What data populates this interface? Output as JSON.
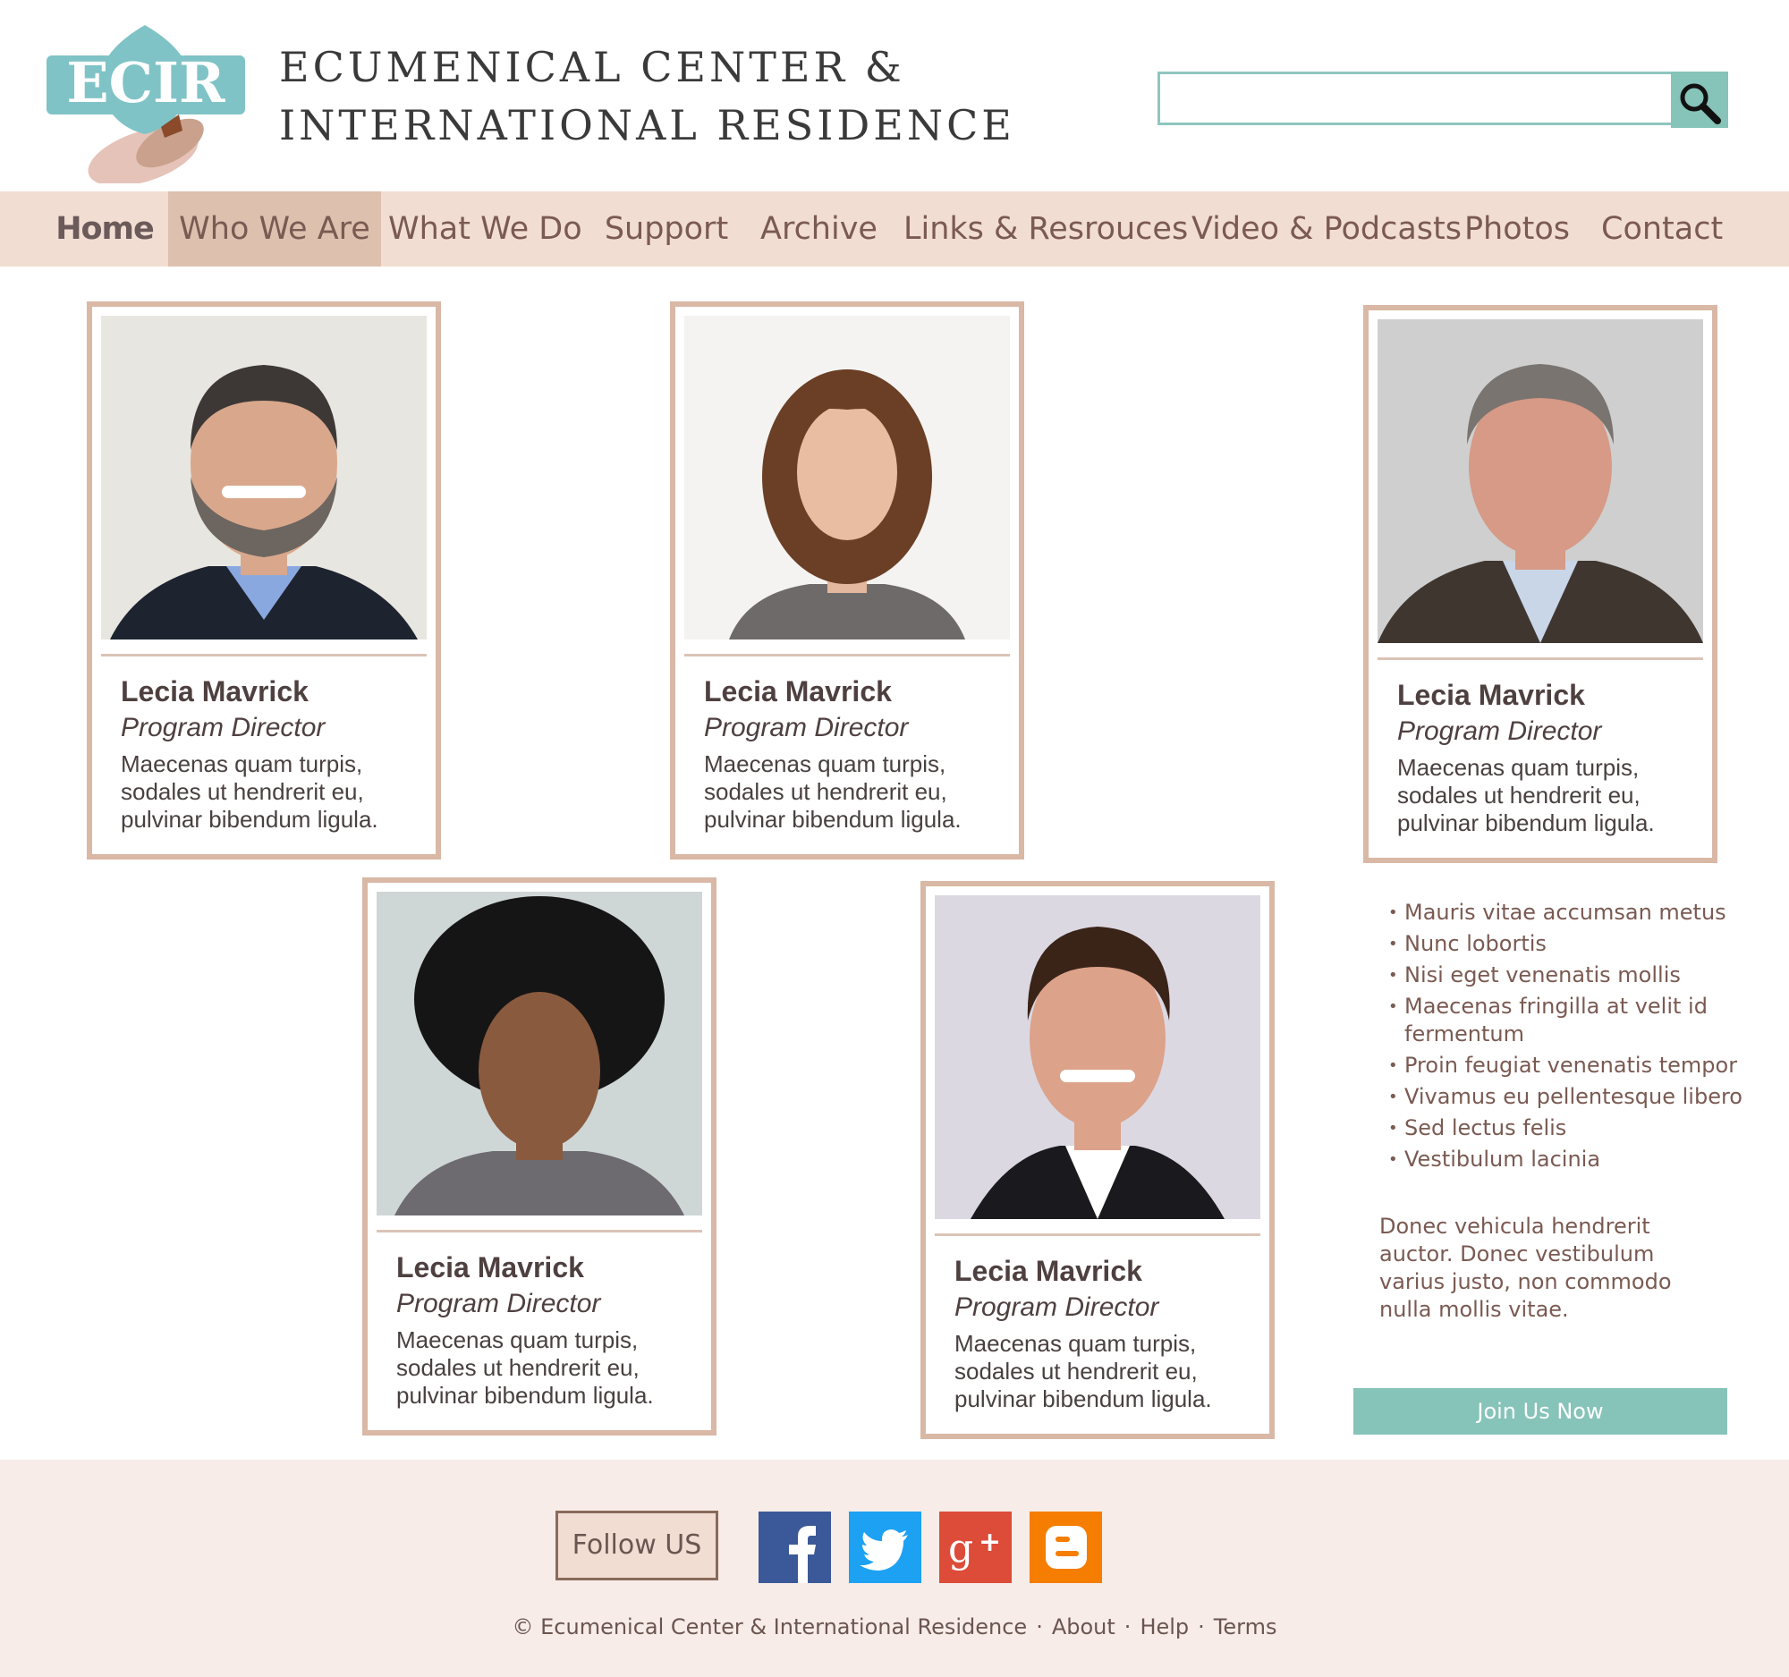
{
  "brand": {
    "logo_text": "ECIR",
    "title_line1": "ECUMENICAL CENTER &",
    "title_line2": "INTERNATIONAL RESIDENCE",
    "colors": {
      "teal": "#86c3b9",
      "nav_bg": "#f2ddd3",
      "card_border": "#d9b8a6",
      "footer_bg": "#f7ece8"
    }
  },
  "search": {
    "placeholder": "",
    "value": "",
    "button_icon": "search-icon"
  },
  "nav": {
    "items": [
      {
        "label": "Home"
      },
      {
        "label": "Who We Are"
      },
      {
        "label": "What We Do"
      },
      {
        "label": "Support"
      },
      {
        "label": "Archive"
      },
      {
        "label": "Links & Resrouces"
      },
      {
        "label": "Video & Podcasts"
      },
      {
        "label": "Photos"
      },
      {
        "label": "Contact"
      }
    ],
    "active": "Who We Are"
  },
  "staff": [
    {
      "name": "Lecia Mavrick",
      "role": "Program Director",
      "bio": "Maecenas quam turpis, sodales ut hendrerit eu, pulvinar bibendum ligula."
    },
    {
      "name": "Lecia Mavrick",
      "role": "Program Director",
      "bio": "Maecenas quam turpis, sodales ut hendrerit eu, pulvinar bibendum ligula."
    },
    {
      "name": "Lecia Mavrick",
      "role": "Program Director",
      "bio": "Maecenas quam turpis, sodales ut hendrerit eu, pulvinar bibendum ligula."
    },
    {
      "name": "Lecia Mavrick",
      "role": "Program Director",
      "bio": "Maecenas quam turpis, sodales ut hendrerit eu, pulvinar bibendum ligula."
    },
    {
      "name": "Lecia Mavrick",
      "role": "Program Director",
      "bio": "Maecenas quam turpis, sodales ut hendrerit eu, pulvinar bibendum ligula."
    }
  ],
  "sidebar": {
    "bullets": [
      "Mauris vitae accumsan metus",
      "Nunc lobortis",
      "Nisi eget venenatis mollis",
      "Maecenas fringilla at velit id fermentum",
      "Proin feugiat venenatis tempor",
      "Vivamus eu pellentesque libero",
      "Sed lectus felis",
      "Vestibulum lacinia"
    ],
    "paragraph": "Donec vehicula hendrerit auctor. Donec vestibulum varius justo, non commodo nulla mollis vitae.",
    "join_label": "Join Us Now"
  },
  "footer": {
    "follow_label": "Follow US",
    "social": [
      {
        "icon": "facebook-icon",
        "color": "#3b5998"
      },
      {
        "icon": "twitter-icon",
        "color": "#1da1f2"
      },
      {
        "icon": "google-plus-icon",
        "color": "#dd4b39"
      },
      {
        "icon": "blogger-icon",
        "color": "#f57d00"
      }
    ],
    "copyright": "© Ecumenical Center & International Residence",
    "links": [
      "About",
      "Help",
      "Terms"
    ]
  }
}
